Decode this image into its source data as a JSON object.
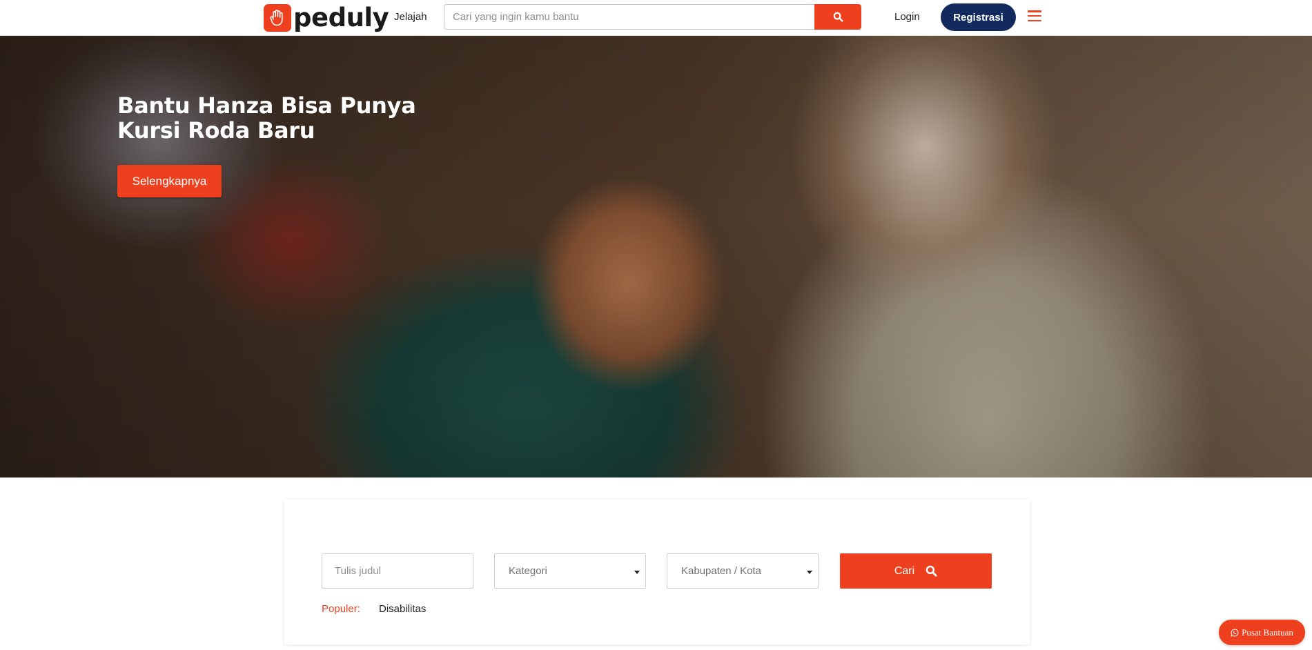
{
  "header": {
    "logo_text": "peduly",
    "nav_jelajah": "Jelajah",
    "search_placeholder": "Cari yang ingin kamu bantu",
    "login_label": "Login",
    "register_label": "Registrasi",
    "icons": {
      "logo": "hand-icon",
      "search": "search-icon",
      "menu": "hamburger-menu-icon"
    }
  },
  "hero": {
    "title": "Bantu Hanza Bisa Punya Kursi Roda Baru",
    "button_label": "Selengkapnya"
  },
  "filter": {
    "title_placeholder": "Tulis judul",
    "kategori_value": "Kategori",
    "kota_value": "Kabupaten / Kota",
    "search_button_label": "Cari",
    "populer_label": "Populer:",
    "populer_items": [
      "Disabilitas"
    ]
  },
  "help": {
    "label": "Pusat Bantuan",
    "icon": "whatsapp-icon"
  },
  "colors": {
    "accent": "#ee3f1f",
    "navy": "#132a5e"
  }
}
